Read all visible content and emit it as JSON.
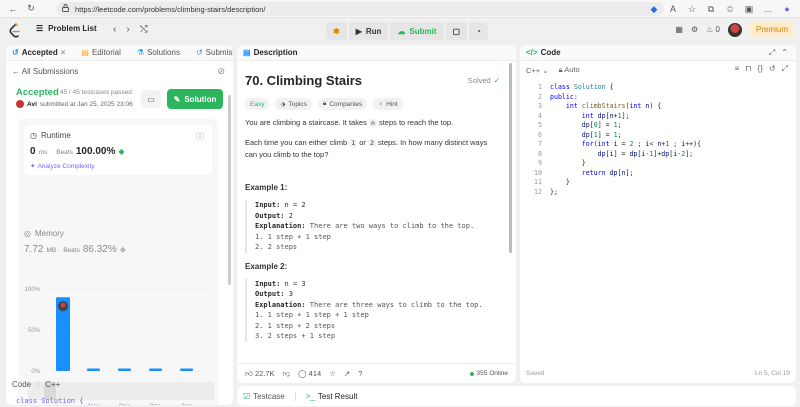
{
  "browser": {
    "url": "https://leetcode.com/problems/climbing-stairs/description/"
  },
  "header": {
    "problem_list": "Problem List",
    "run": "Run",
    "submit": "Submit",
    "fire_count": "0",
    "premium": "Premium"
  },
  "left": {
    "tabs": [
      "Accepted",
      "Editorial",
      "Solutions",
      "Submissions"
    ],
    "all_submissions": "All Submissions",
    "status": "Accepted",
    "passed": "45 / 45 testcases passed",
    "user": "Avi",
    "submitted": "submitted at Jan 25, 2025 23:06",
    "solution_btn": "Solution",
    "runtime_label": "Runtime",
    "runtime_value": "0",
    "runtime_unit": "ms",
    "beats_label": "Beats",
    "runtime_beats": "100.00%",
    "analyze": "Analyze Complexity",
    "memory_label": "Memory",
    "memory_value": "7.72",
    "memory_unit": "MB",
    "memory_beats": "86.32%",
    "code_label": "Code",
    "lang": "C++",
    "code_peek": "class Solution {"
  },
  "chart_data": {
    "type": "bar",
    "categories": [
      "0ms",
      "1ms",
      "2ms",
      "3ms",
      "4ms"
    ],
    "tick_labels": [
      "",
      "1ms",
      "2ms",
      "3ms",
      "4ms"
    ],
    "values": [
      90,
      3,
      3,
      3,
      3
    ],
    "ylim": [
      0,
      100
    ],
    "yticks": [
      "100%",
      "50%",
      "0%"
    ],
    "highlight_index": 0,
    "bar_color": "#1890ff"
  },
  "mid": {
    "tab": "Description",
    "title": "70. Climbing Stairs",
    "solved": "Solved",
    "chips": [
      "Easy",
      "Topics",
      "Companies",
      "Hint"
    ],
    "p1_a": "You are climbing a staircase. It takes ",
    "p1_code": "n",
    "p1_b": " steps to reach the top.",
    "p2_a": "Each time you can either climb ",
    "p2_c1": "1",
    "p2_or": " or ",
    "p2_c2": "2",
    "p2_b": " steps. In how many distinct ways can you climb to the top?",
    "ex1_title": "Example 1:",
    "ex1_input_label": "Input:",
    "ex1_input": "n = 2",
    "ex1_output_label": "Output:",
    "ex1_output": "2",
    "ex1_expl_label": "Explanation:",
    "ex1_expl": "There are two ways to climb to the top.",
    "ex1_lines": [
      "1. 1 step + 1 step",
      "2. 2 steps"
    ],
    "ex2_title": "Example 2:",
    "ex2_input_label": "Input:",
    "ex2_input": "n = 3",
    "ex2_output_label": "Output:",
    "ex2_output": "3",
    "ex2_expl_label": "Explanation:",
    "ex2_expl": "There are three ways to climb to the top.",
    "ex2_lines": [
      "1. 1 step + 1 step + 1 step",
      "2. 1 step + 2 steps",
      "3. 2 steps + 1 step"
    ],
    "likes": "22.7K",
    "comments": "414",
    "online": "355 Online"
  },
  "bottom": {
    "testcase": "Testcase",
    "test_result": "Test Result"
  },
  "right": {
    "tab": "Code",
    "lang": "C++",
    "mode": "Auto",
    "saved": "Saved",
    "cursor": "Ln 5, Col 19",
    "code_lines": [
      "class Solution {",
      "public:",
      "    int climbStairs(int n) {",
      "        int dp[n+1];",
      "        dp[0] = 1;",
      "        dp[1] = 1;",
      "        for(int i = 2 ; i< n+1 ; i++){",
      "            dp[i] = dp[i-1]+dp[i-2];",
      "        }",
      "        return dp[n];",
      "    }",
      "};"
    ]
  },
  "colors": {
    "accent_green": "#2db55d",
    "bar_blue": "#1890ff",
    "premium": "#d48806"
  }
}
